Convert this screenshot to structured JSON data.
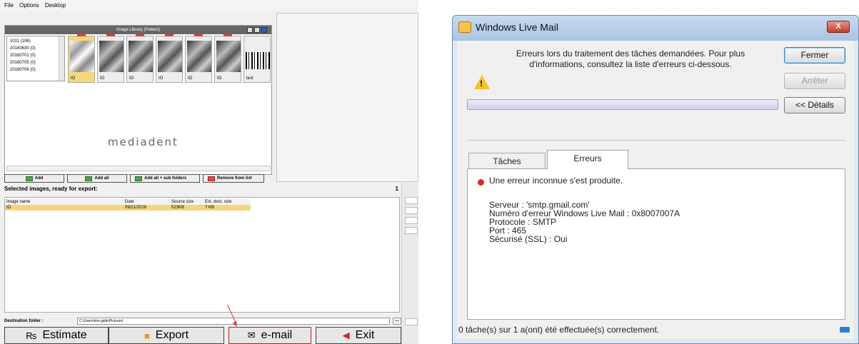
{
  "mediadent": {
    "menu": [
      "File",
      "Options",
      "Desktop"
    ],
    "library_title": "Image Library (Patient)",
    "dates": [
      "1011 (106)",
      "20160630 (0)",
      "20160701 (0)",
      "20160705 (0)",
      "20160706 (0)"
    ],
    "thumbnails": [
      {
        "caption": "IO",
        "selected": true
      },
      {
        "caption": "IO",
        "selected": false
      },
      {
        "caption": "IO",
        "selected": false
      },
      {
        "caption": "IO",
        "selected": false
      },
      {
        "caption": "IO",
        "selected": false
      },
      {
        "caption": "IO",
        "selected": false
      },
      {
        "caption": "test",
        "selected": false
      }
    ],
    "logo": "mediadent",
    "buttons": {
      "add": "Add",
      "add_all": "Add all",
      "add_all_sub": "Add all + sub folders",
      "remove": "Remove from list"
    },
    "selected_title": "Selected images, ready for export:",
    "selected_count": "1",
    "table": {
      "headers": [
        "Image name",
        "Date",
        "Source size",
        "Est. dest. size"
      ],
      "rows": [
        [
          "IO",
          "09/21/2016",
          "523KB",
          "? KB"
        ]
      ]
    },
    "destination_label": "Destination folder :",
    "destination_value": "C:\\Users\\kris.galle\\Pictures\\",
    "browse_label": "...",
    "actions": {
      "estimate": "Estimate",
      "export": "Export",
      "email": "e-mail",
      "exit": "Exit"
    }
  },
  "wlm": {
    "title": "Windows Live Mail",
    "close_glyph": "X",
    "message": "Erreurs lors du traitement des tâches demandées. Pour plus d'informations, consultez la liste d'erreurs ci-dessous.",
    "btn_close": "Fermer",
    "btn_stop": "Arrêter",
    "btn_details": "<< Détails",
    "tabs": [
      "Tâches",
      "Erreurs"
    ],
    "error_title": "Une erreur inconnue s'est produite.",
    "error_details": [
      "Serveur : 'smtp.gmail.com'",
      "Numéro d'erreur Windows Live Mail : 0x8007007A",
      "Protocole : SMTP",
      "Port : 465",
      "Sécurisé (SSL) : Oui"
    ],
    "status": "0 tâche(s) sur 1 a(ont) été effectuée(s) correctement."
  },
  "colors": {
    "selection": "#f6d57a",
    "error": "#d72b1d",
    "annotation_arrow": "#e23030"
  }
}
